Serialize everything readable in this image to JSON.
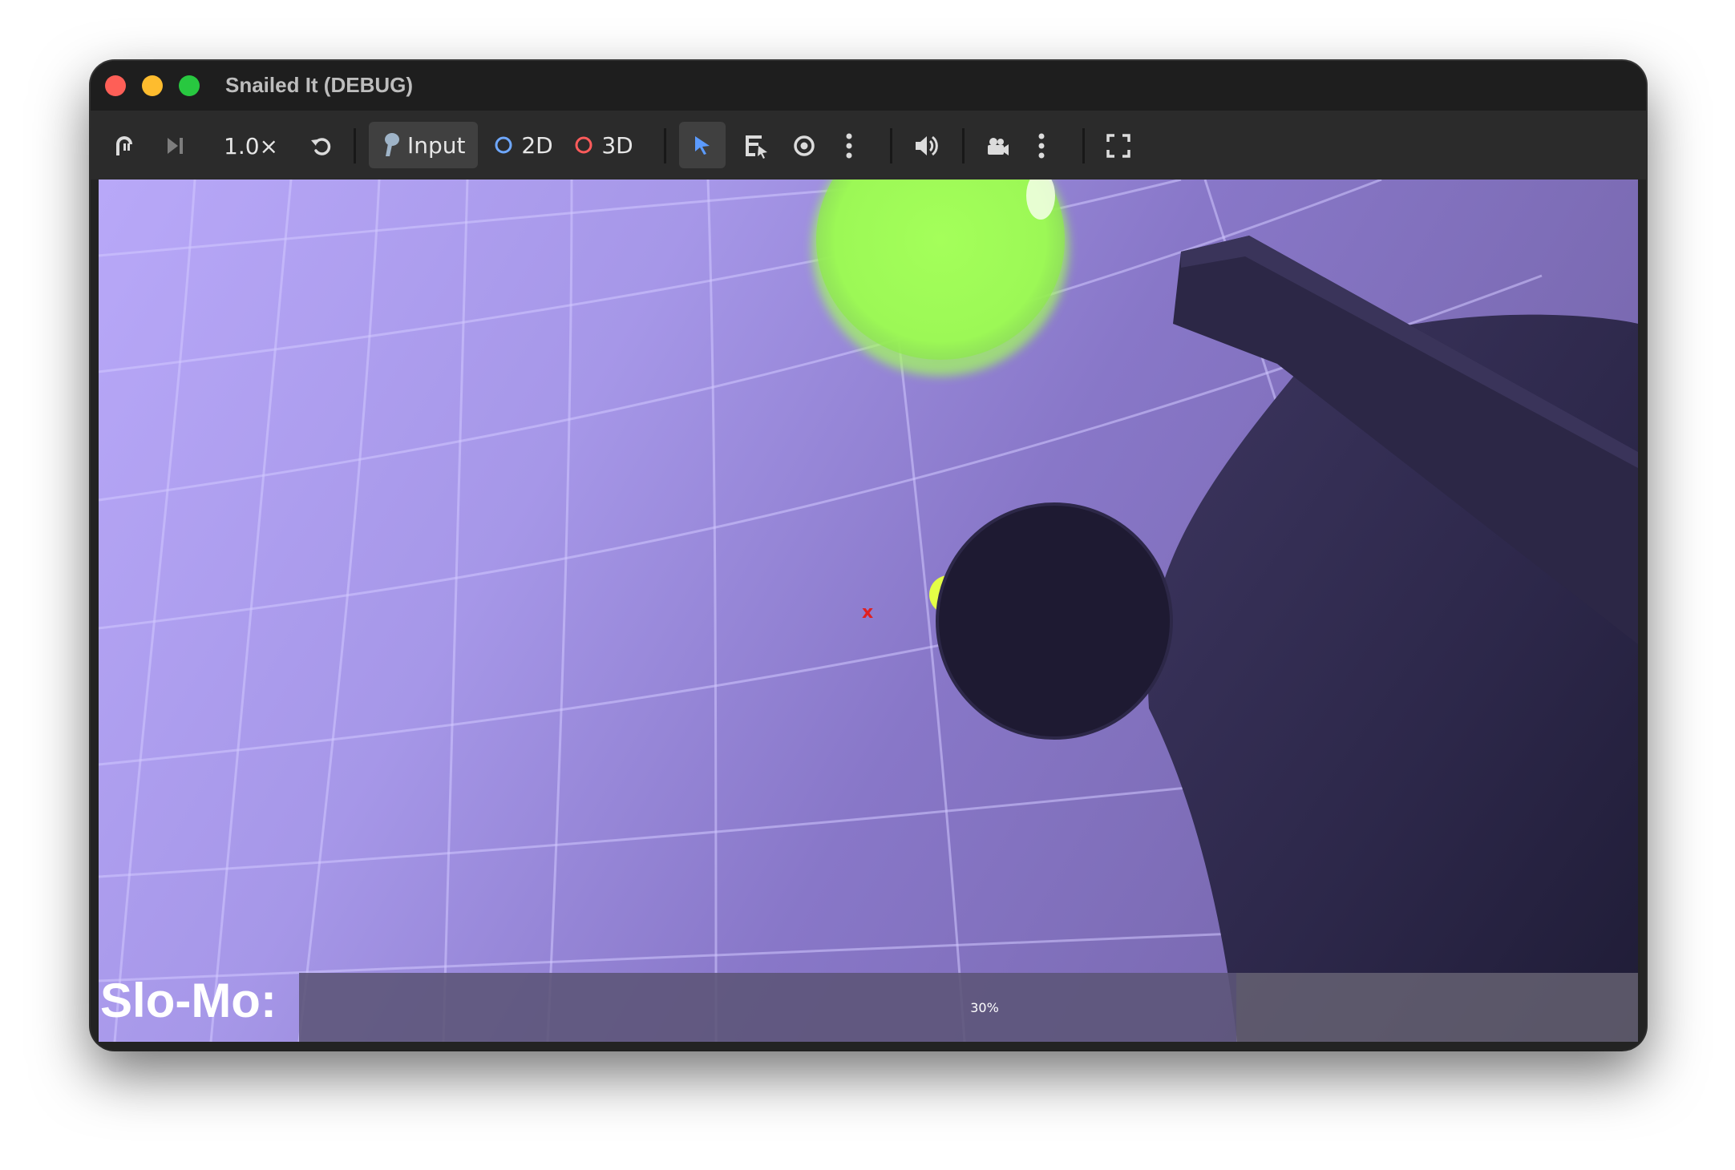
{
  "window": {
    "title": "Snailed It (DEBUG)"
  },
  "toolbar": {
    "speed_label": "1.0×",
    "input_label": "Input",
    "mode_2d_label": "2D",
    "mode_3d_label": "3D",
    "icons": {
      "suspend": "game-suspend-icon",
      "next_frame": "next-frame-icon",
      "reset_speed": "reset-speed-icon",
      "input": "joystick-icon",
      "mode_2d": "circle-outline-icon",
      "mode_3d": "circle-outline-icon",
      "select": "cursor-arrow-icon",
      "list_select": "list-select-icon",
      "visibility": "eye-icon",
      "more1": "kebab-menu-icon",
      "audio": "speaker-icon",
      "camera": "camera-override-icon",
      "more2": "kebab-menu-icon",
      "fullscreen": "fullscreen-icon"
    },
    "colors": {
      "mode_2d_icon": "#6fa8ff",
      "mode_3d_icon": "#ff5b5b",
      "select_icon": "#5b9bff"
    }
  },
  "game": {
    "crosshair": "x",
    "slomo_label": "Slo-Mo:",
    "slomo_percent_text": "30%",
    "slomo_fill_fraction": 0.3
  }
}
